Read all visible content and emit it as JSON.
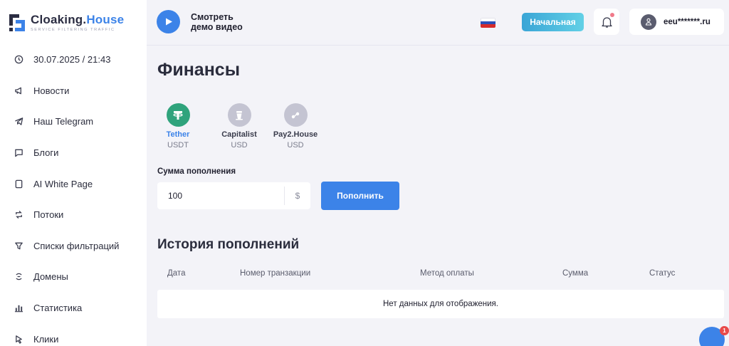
{
  "brand": {
    "name_part1": "Cloaking.",
    "name_part2": "House",
    "tagline": "SERVICE FILTERING TRAFFIC",
    "accent_color": "#3c83e8"
  },
  "sidebar": {
    "items": [
      {
        "label": "30.07.2025 / 21:43",
        "icon": "clock-icon"
      },
      {
        "label": "Новости",
        "icon": "megaphone-icon"
      },
      {
        "label": "Наш Telegram",
        "icon": "telegram-icon"
      },
      {
        "label": "Блоги",
        "icon": "chat-bubble-icon"
      },
      {
        "label": "AI White Page",
        "icon": "document-icon"
      },
      {
        "label": "Потоки",
        "icon": "flows-icon"
      },
      {
        "label": "Списки фильтраций",
        "icon": "filter-icon"
      },
      {
        "label": "Домены",
        "icon": "domain-icon"
      },
      {
        "label": "Статистика",
        "icon": "bar-chart-icon"
      },
      {
        "label": "Клики",
        "icon": "cursor-icon"
      }
    ]
  },
  "topbar": {
    "demo_label": "Смотреть демо видео",
    "home_label": "Начальная",
    "user_name": "eeu*******.ru",
    "language_flag": "russian-flag-icon"
  },
  "main": {
    "title": "Финансы",
    "methods": [
      {
        "name": "Tether",
        "currency": "USDT",
        "selected": true,
        "color": "#2fa37c"
      },
      {
        "name": "Capitalist",
        "currency": "USD",
        "selected": false,
        "color": "#b9b9c8"
      },
      {
        "name": "Pay2.House",
        "currency": "USD",
        "selected": false,
        "color": "#b9b9c8"
      }
    ],
    "amount_label": "Сумма пополнения",
    "amount_value": "100",
    "amount_currency": "$",
    "topup_label": "Пополнить",
    "history_title": "История пополнений",
    "table_columns": [
      "Дата",
      "Номер транзакции",
      "Метод оплаты",
      "Сумма",
      "Статус"
    ],
    "table_empty": "Нет данных для отображения."
  },
  "chat": {
    "badge_count": "1"
  }
}
